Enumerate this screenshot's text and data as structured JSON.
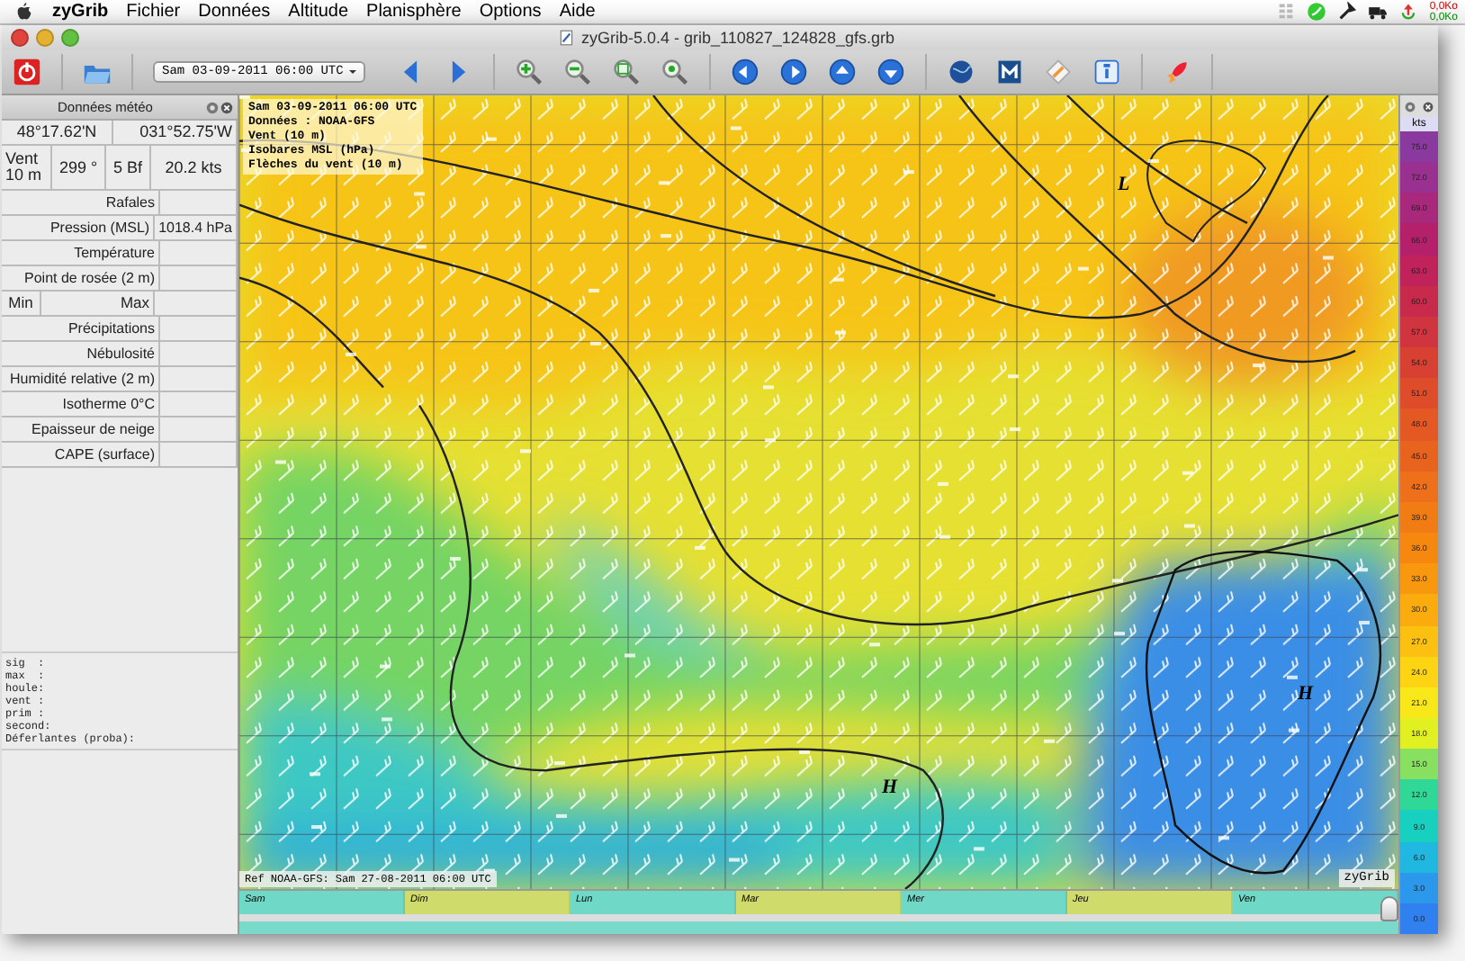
{
  "menubar": {
    "app": "zyGrib",
    "items": [
      "Fichier",
      "Données",
      "Altitude",
      "Planisphère",
      "Options",
      "Aide"
    ],
    "net_up": "0,0Ko",
    "net_down": "0,0Ko"
  },
  "window": {
    "title": "zyGrib-5.0.4 - grib_110827_124828_gfs.grb"
  },
  "toolbar": {
    "date": "Sam 03-09-2011 06:00 UTC"
  },
  "data_panel": {
    "title": "Données météo",
    "latitude": "48°17.62'N",
    "longitude": "031°52.75'W",
    "wind": [
      "Vent\n10 m",
      "299 °",
      "5 Bf",
      "20.2  kts"
    ],
    "rows": [
      {
        "kind": "value",
        "label": "Rafales",
        "value": ""
      },
      {
        "kind": "value",
        "label": "Pression (MSL)",
        "value": "1018.4 hPa"
      },
      {
        "kind": "value",
        "label": "Température",
        "value": ""
      },
      {
        "kind": "value",
        "label": "Point de rosée (2 m)",
        "value": ""
      },
      {
        "kind": "minmax",
        "label": "Min",
        "label_2": "Max"
      },
      {
        "kind": "value",
        "label": "Précipitations",
        "value": ""
      },
      {
        "kind": "value",
        "label": "Nébulosité",
        "value": ""
      },
      {
        "kind": "value",
        "label": "Humidité relative (2 m)",
        "value": ""
      },
      {
        "kind": "value",
        "label": "Isotherme 0°C",
        "value": ""
      },
      {
        "kind": "value",
        "label": "Epaisseur de neige",
        "value": ""
      },
      {
        "kind": "value",
        "label": "CAPE (surface)",
        "value": ""
      }
    ],
    "wave_lines": [
      "sig  :",
      "max  :",
      "houle:",
      "vent :",
      "prim :",
      "second:",
      "Déferlantes (proba):"
    ]
  },
  "map": {
    "info_lines": [
      "Sam 03-09-2011 06:00 UTC",
      "Données : NOAA-GFS",
      "Vent (10 m)",
      "Isobares MSL (hPa)",
      "Flèches du vent (10 m)"
    ],
    "pressure_centers": [
      {
        "letter": "L"
      },
      {
        "letter": "H"
      },
      {
        "letter": "H"
      }
    ],
    "reference": "Ref NOAA-GFS: Sam 27-08-2011 06:00 UTC",
    "brand": "zyGrib"
  },
  "legend": {
    "unit": "kts",
    "bands": [
      {
        "value": "75.0",
        "color": "#8a3a9e"
      },
      {
        "value": "72.0",
        "color": "#9a3090"
      },
      {
        "value": "69.0",
        "color": "#a8287c"
      },
      {
        "value": "66.0",
        "color": "#b4206a"
      },
      {
        "value": "63.0",
        "color": "#c0225a"
      },
      {
        "value": "60.0",
        "color": "#c82a4c"
      },
      {
        "value": "57.0",
        "color": "#d0343e"
      },
      {
        "value": "54.0",
        "color": "#d84032"
      },
      {
        "value": "51.0",
        "color": "#de4c2a"
      },
      {
        "value": "48.0",
        "color": "#e45824"
      },
      {
        "value": "45.0",
        "color": "#e8641e"
      },
      {
        "value": "42.0",
        "color": "#ee701a"
      },
      {
        "value": "39.0",
        "color": "#f27c14"
      },
      {
        "value": "36.0",
        "color": "#f68810"
      },
      {
        "value": "33.0",
        "color": "#f8980e"
      },
      {
        "value": "30.0",
        "color": "#faac0e"
      },
      {
        "value": "27.0",
        "color": "#fcc010"
      },
      {
        "value": "24.0",
        "color": "#fcd414"
      },
      {
        "value": "21.0",
        "color": "#f8e81a"
      },
      {
        "value": "18.0",
        "color": "#e0f020"
      },
      {
        "value": "15.0",
        "color": "#88e060"
      },
      {
        "value": "12.0",
        "color": "#30d898"
      },
      {
        "value": "9.0",
        "color": "#18d0c0"
      },
      {
        "value": "6.0",
        "color": "#20b8e0"
      },
      {
        "value": "3.0",
        "color": "#2c98ec"
      },
      {
        "value": "0.0",
        "color": "#3080f0"
      }
    ]
  },
  "timeline": {
    "level": 1,
    "days": [
      {
        "label": "Sam",
        "color": "#6fd8c6"
      },
      {
        "label": "Dim",
        "color": "#cfdb6a"
      },
      {
        "label": "Lun",
        "color": "#6fd8c6"
      },
      {
        "label": "Mar",
        "color": "#cfdb6a"
      },
      {
        "label": "Mer",
        "color": "#6fd8c6"
      },
      {
        "label": "Jeu",
        "color": "#cfdb6a"
      },
      {
        "label": "Ven",
        "color": "#6fd8c6"
      }
    ]
  }
}
